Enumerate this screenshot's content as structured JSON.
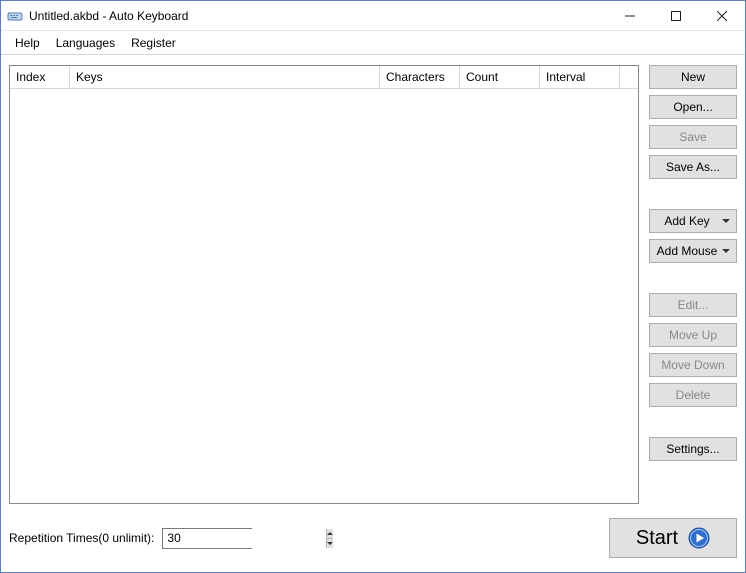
{
  "window": {
    "title": "Untitled.akbd - Auto Keyboard"
  },
  "menu": {
    "help": "Help",
    "languages": "Languages",
    "register": "Register"
  },
  "table": {
    "headers": {
      "index": "Index",
      "keys": "Keys",
      "characters": "Characters",
      "count": "Count",
      "interval": "Interval"
    }
  },
  "buttons": {
    "new": "New",
    "open": "Open...",
    "save": "Save",
    "save_as": "Save As...",
    "add_key": "Add Key",
    "add_mouse": "Add Mouse",
    "edit": "Edit...",
    "move_up": "Move Up",
    "move_down": "Move Down",
    "delete": "Delete",
    "settings": "Settings..."
  },
  "bottom": {
    "rep_label": "Repetition Times(0 unlimit):",
    "rep_value": "30",
    "start": "Start"
  }
}
